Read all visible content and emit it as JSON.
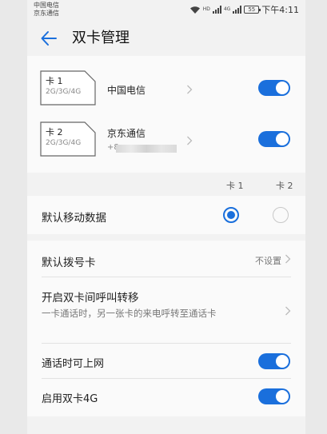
{
  "status_bar": {
    "carrier_1": "中国电信",
    "carrier_2": "京东通信",
    "battery": "55",
    "time": "下午4:11",
    "network_1": "HD",
    "network_2": "4G"
  },
  "header": {
    "title": "双卡管理"
  },
  "sims": [
    {
      "card_label": "卡 1",
      "types": "2G/3G/4G",
      "operator": "中国电信",
      "number": "",
      "enabled": true
    },
    {
      "card_label": "卡 2",
      "types": "2G/3G/4G",
      "operator": "京东通信",
      "number": "+8",
      "enabled": true
    }
  ],
  "columns": {
    "card1": "卡 1",
    "card2": "卡 2"
  },
  "default_data": {
    "label": "默认移动数据",
    "selected": "card1"
  },
  "settings": {
    "default_dial": {
      "label": "默认拨号卡",
      "value": "不设置"
    },
    "call_forward": {
      "label": "开启双卡间呼叫转移",
      "description": "一卡通话时，另一张卡的来电呼转至通话卡"
    },
    "data_during_call": {
      "label": "通话时可上网",
      "enabled": true
    },
    "dual_4g": {
      "label": "启用双卡4G",
      "enabled": true
    }
  },
  "colors": {
    "accent": "#1a6fdc",
    "background": "#f2f2f2",
    "card": "#fafafa"
  },
  "icons": [
    "back-arrow-icon",
    "sim-card-icon",
    "chevron-right-icon",
    "wifi-icon",
    "signal-icon",
    "battery-icon"
  ]
}
